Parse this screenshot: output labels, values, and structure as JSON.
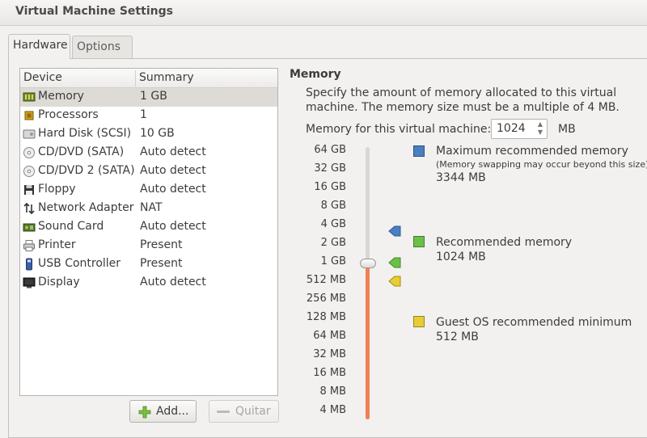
{
  "window": {
    "title": "Virtual Machine Settings"
  },
  "tabs": [
    {
      "label": "Hardware",
      "active": true
    },
    {
      "label": "Options",
      "active": false
    }
  ],
  "devices": {
    "headers": {
      "device": "Device",
      "summary": "Summary"
    },
    "rows": [
      {
        "name": "Memory",
        "summary": "1 GB",
        "icon": "memory-icon",
        "selected": true
      },
      {
        "name": "Processors",
        "summary": "1",
        "icon": "processor-icon"
      },
      {
        "name": "Hard Disk (SCSI)",
        "summary": "10 GB",
        "icon": "hard-disk-icon"
      },
      {
        "name": "CD/DVD (SATA)",
        "summary": "Auto detect",
        "icon": "cd-dvd-icon"
      },
      {
        "name": "CD/DVD 2 (SATA)",
        "summary": "Auto detect",
        "icon": "cd-dvd-icon"
      },
      {
        "name": "Floppy",
        "summary": "Auto detect",
        "icon": "floppy-icon"
      },
      {
        "name": "Network Adapter",
        "summary": "NAT",
        "icon": "network-icon"
      },
      {
        "name": "Sound Card",
        "summary": "Auto detect",
        "icon": "sound-card-icon"
      },
      {
        "name": "Printer",
        "summary": "Present",
        "icon": "printer-icon"
      },
      {
        "name": "USB Controller",
        "summary": "Present",
        "icon": "usb-icon"
      },
      {
        "name": "Display",
        "summary": "Auto detect",
        "icon": "display-icon"
      }
    ]
  },
  "buttons": {
    "add": "Add...",
    "remove": "Quitar"
  },
  "memory": {
    "title": "Memory",
    "description": "Specify the amount of memory allocated to this virtual machine. The memory size must be a multiple of 4 MB.",
    "field_label": "Memory for this virtual machine:",
    "value": "1024",
    "unit": "MB",
    "scale": [
      "64 GB",
      "32 GB",
      "16 GB",
      "8 GB",
      "4 GB",
      "2 GB",
      "1 GB",
      "512 MB",
      "256 MB",
      "128 MB",
      "64 MB",
      "32 MB",
      "16 MB",
      "8 MB",
      "4 MB"
    ],
    "slider_value": "1 GB",
    "legend": {
      "max": {
        "title": "Maximum recommended memory",
        "note": "(Memory swapping may occur beyond this size)",
        "value": "3344 MB",
        "color": "#4a7fc1"
      },
      "recommended": {
        "title": "Recommended memory",
        "value": "1024 MB",
        "color": "#6cc04a"
      },
      "minimum": {
        "title": "Guest OS recommended minimum",
        "value": "512 MB",
        "color": "#e8cc35"
      }
    },
    "colors": {
      "fill": "#ef8155"
    }
  }
}
